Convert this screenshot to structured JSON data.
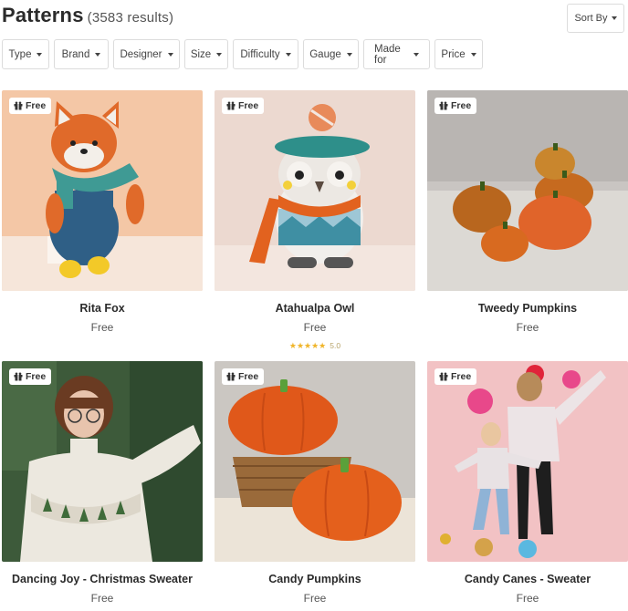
{
  "header": {
    "title": "Patterns",
    "result_count": "(3583 results)",
    "sort_label": "Sort By"
  },
  "filters": [
    "Type",
    "Brand",
    "Designer",
    "Size",
    "Difficulty",
    "Gauge",
    "Made for",
    "Price"
  ],
  "colors": {
    "badge_bg": "#ffffff",
    "star": "#f0b52a",
    "border": "#dcdcdc"
  },
  "products": [
    {
      "name": "Rita Fox",
      "price": "Free",
      "badge": "Free",
      "image": "crochet-fox-amigurumi"
    },
    {
      "name": "Atahualpa Owl",
      "price": "Free",
      "badge": "Free",
      "rating_stars": "★★★★★",
      "rating_value": "5.0",
      "image": "crochet-owl-amigurumi"
    },
    {
      "name": "Tweedy Pumpkins",
      "price": "Free",
      "badge": "Free",
      "image": "crochet-pumpkins"
    },
    {
      "name": "Dancing Joy - Christmas Sweater",
      "price": "Free",
      "badge": "Free",
      "image": "woman-knit-sweater"
    },
    {
      "name": "Candy Pumpkins",
      "price": "Free",
      "badge": "Free",
      "image": "orange-pumpkins-basket"
    },
    {
      "name": "Candy Canes - Sweater",
      "price": "Free",
      "badge": "Free",
      "image": "family-christmas-sweaters"
    }
  ]
}
